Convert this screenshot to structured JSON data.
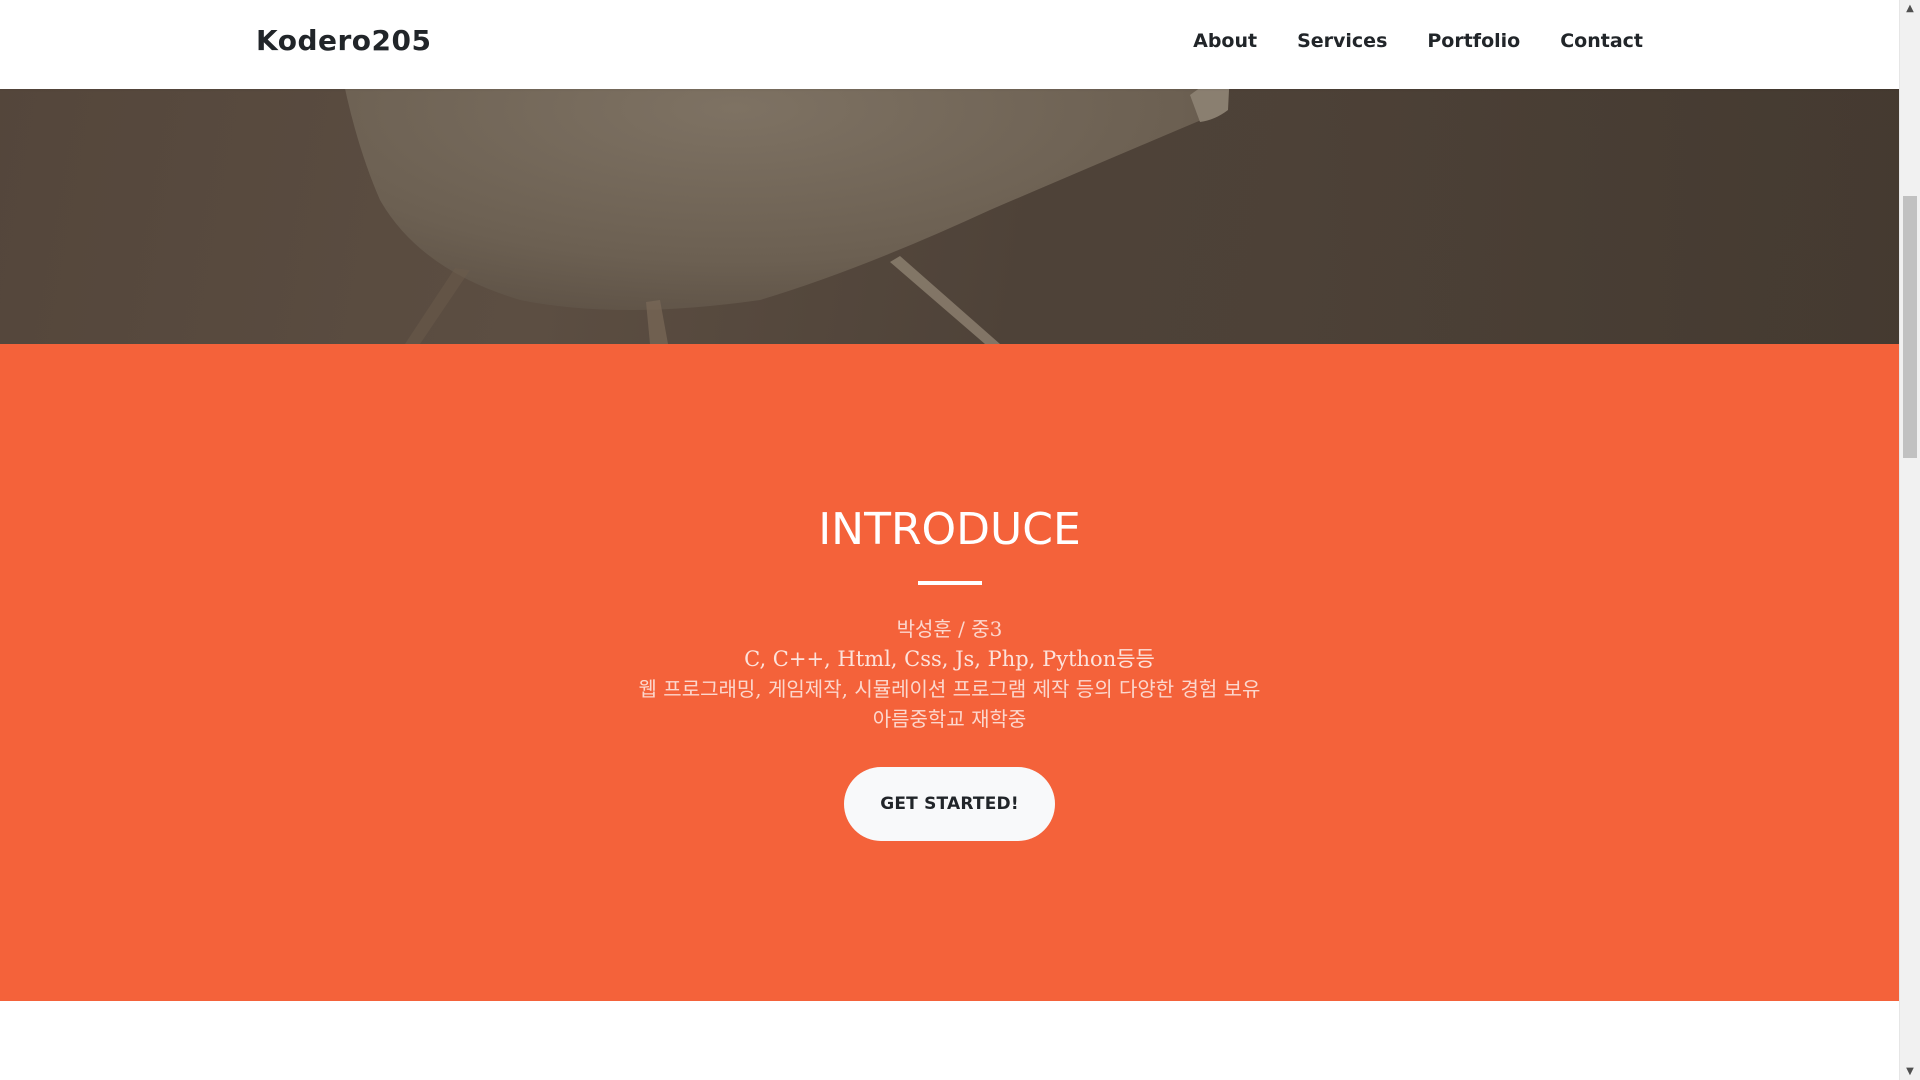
{
  "navbar": {
    "brand": "Kodero205",
    "links": [
      {
        "label": "About"
      },
      {
        "label": "Services"
      },
      {
        "label": "Portfolio"
      },
      {
        "label": "Contact"
      }
    ]
  },
  "intro": {
    "title": "INTRODUCE",
    "lines": [
      "박성훈 / 중3",
      "C, C++, Html, Css, Js, Php, Python등등",
      "웹 프로그래밍, 게임제작, 시뮬레이션 프로그램 제작 등의 다양한 경험 보유",
      "아름중학교 재학중"
    ],
    "button_label": "GET STARTED!"
  },
  "colors": {
    "accent": "#f4623a",
    "hero_overlay": "#4e4238",
    "button_bg": "#f8f9fa",
    "text_dark": "#212529"
  },
  "scrollbar": {
    "up_icon": "triangle-up-icon",
    "down_icon": "triangle-down-icon"
  }
}
